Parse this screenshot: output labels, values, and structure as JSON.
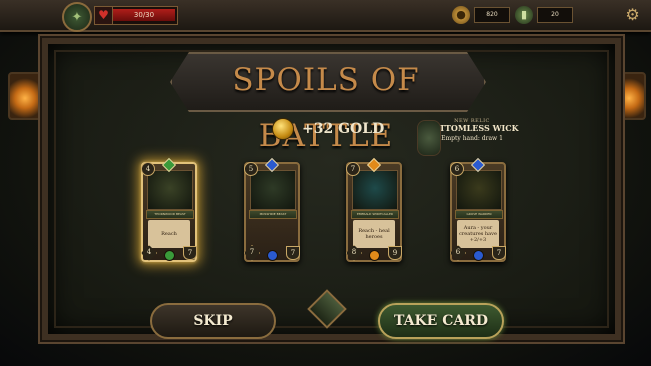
{
  "top_bar": {
    "emblem_icon": "tree-emblem-icon",
    "health": {
      "text": "30/30",
      "current": 30,
      "max": 30,
      "icon": "heart-icon"
    },
    "gold": {
      "value": "820",
      "icon": "gold-pouch-icon"
    },
    "deck": {
      "value": "20",
      "icon": "deck-icon"
    },
    "settings_icon": "gear-icon"
  },
  "title": "SPOILS OF BATTLE",
  "gold_reward": {
    "text": "+32 GOLD",
    "icon": "gold-coins-icon"
  },
  "relic": {
    "label": "NEW RELIC",
    "name": "BOTTOMLESS WICK",
    "effect": "Empty hand: draw 1",
    "icon": "wick-lantern-icon"
  },
  "cards": [
    {
      "name": "THORNWOOD BEAST",
      "cost": "4",
      "attack": "4",
      "health": "7",
      "text": "Reach",
      "gem_color": "#3a9a3a",
      "art": "#3a4226",
      "selected": true
    },
    {
      "name": "MOSSHIDE BEAST",
      "cost": "5",
      "attack": "7",
      "health": "7",
      "text": "",
      "gem_color": "#2a5ad0",
      "art": "#2e3a26",
      "selected": false
    },
    {
      "name": "EMERALD SPIRITCALLER",
      "cost": "7",
      "attack": "8",
      "health": "9",
      "text": "Reach - heal heroes",
      "gem_color": "#e08a1a",
      "art": "#1e4a4a",
      "selected": false
    },
    {
      "name": "GROVE WARDEN",
      "cost": "6",
      "attack": "6",
      "health": "7",
      "text": "Aura - your creatures have +2/+3",
      "gem_color": "#2a5ad0",
      "art": "#3a3a1c",
      "selected": false
    }
  ],
  "buttons": {
    "skip": "SKIP",
    "take": "TAKE CARD"
  }
}
